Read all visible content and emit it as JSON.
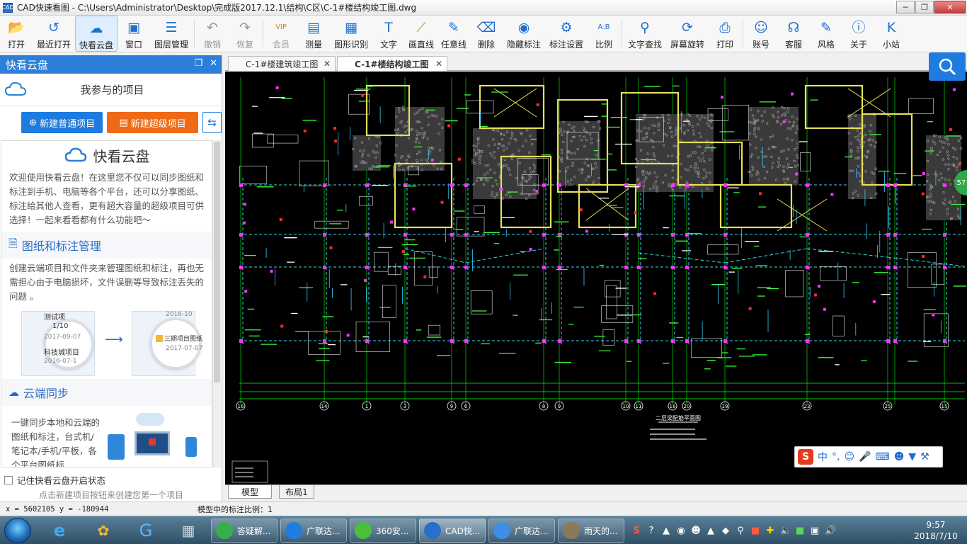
{
  "window": {
    "title": "CAD快速看图 - C:\\Users\\Administrator\\Desktop\\完成版2017.12.1\\结构\\C区\\C-1#楼结构竣工图.dwg",
    "app_icon_text": "CAD"
  },
  "toolbar": {
    "items": [
      {
        "label": "打开",
        "icon": "folder-open-icon"
      },
      {
        "label": "最近打开",
        "icon": "history-icon"
      },
      {
        "label": "快看云盘",
        "icon": "cloud-icon"
      },
      {
        "label": "窗口",
        "icon": "window-fit-icon"
      },
      {
        "label": "图层管理",
        "icon": "layers-icon"
      },
      {
        "label": "撤销",
        "icon": "undo-icon"
      },
      {
        "label": "恢复",
        "icon": "redo-icon"
      },
      {
        "label": "会员",
        "icon": "vip-icon"
      },
      {
        "label": "测量",
        "icon": "ruler-icon"
      },
      {
        "label": "图形识别",
        "icon": "shape-recognition-icon"
      },
      {
        "label": "文字",
        "icon": "text-icon"
      },
      {
        "label": "画直线",
        "icon": "line-icon"
      },
      {
        "label": "任意线",
        "icon": "pencil-icon"
      },
      {
        "label": "删除",
        "icon": "eraser-icon"
      },
      {
        "label": "隐藏标注",
        "icon": "eye-hide-icon"
      },
      {
        "label": "标注设置",
        "icon": "annotation-settings-icon"
      },
      {
        "label": "比例",
        "icon": "scale-icon"
      },
      {
        "label": "文字查找",
        "icon": "text-search-icon"
      },
      {
        "label": "屏幕旋转",
        "icon": "rotate-screen-icon"
      },
      {
        "label": "打印",
        "icon": "printer-icon"
      },
      {
        "label": "账号",
        "icon": "user-icon"
      },
      {
        "label": "客服",
        "icon": "headset-icon"
      },
      {
        "label": "风格",
        "icon": "style-icon"
      },
      {
        "label": "关于",
        "icon": "info-icon"
      },
      {
        "label": "小站",
        "icon": "k-station-icon"
      }
    ]
  },
  "leftpanel": {
    "header": "快看云盘",
    "title": "我参与的项目",
    "new_normal": "新建普通项目",
    "new_super": "新建超级项目",
    "kc_title": "快看云盘",
    "intro": "欢迎使用快看云盘！在这里您不仅可以同步图纸和标注到手机、电脑等各个平台，还可以分享图纸、标注给其他人查看，更有超大容量的超级项目可供选择！一起来看看都有什么功能吧～",
    "sec1_title": "图纸和标注管理",
    "sec1_text": "创建云端项目和文件夹来管理图纸和标注，再也无需担心由于电脑损坏，文件误删等导致标注丢失的问题 。",
    "illus_left": {
      "t1": "测试项",
      "t2": "1/10",
      "t3": "2017-09-07",
      "t4": "科技城项目",
      "t5": "2016-07-1"
    },
    "illus_right": {
      "t1": "2016-10",
      "t2": "三期项目图纸",
      "t3": "2017-07-07"
    },
    "sec2_title": "云端同步",
    "sec2_text": "一键同步本地和云端的图纸和标注，台式机/笔记本/手机/平板，各个平台图纸标",
    "remember": "记住快看云盘开启状态",
    "hint": "点击新建项目按钮来创建您第一个项目"
  },
  "tabs": [
    {
      "label": "C-1#楼建筑竣工图",
      "active": false
    },
    {
      "label": "C-1#楼结构竣工图",
      "active": true
    }
  ],
  "layout_tabs": {
    "model": "模型",
    "layout1": "布局1"
  },
  "status": {
    "coords": "x = 5602105  y = -180944",
    "scale": "模型中的标注比例：1"
  },
  "ime": {
    "lang": "中",
    "punct": "°,"
  },
  "green_badge": "57",
  "taskbar": {
    "tasks": [
      {
        "label": "答疑解...",
        "color": "#35b04a"
      },
      {
        "label": "广联达...",
        "color": "#1f7fe0"
      },
      {
        "label": "360安...",
        "color": "#4bbf3b"
      },
      {
        "label": "CAD快...",
        "color": "#2a6fc9"
      },
      {
        "label": "广联达...",
        "color": "#3d8fe6"
      },
      {
        "label": "雨天的...",
        "color": "#8a7a5a"
      }
    ],
    "time": "9:57",
    "date": "2018/7/10"
  },
  "drawing": {
    "grid_labels": [
      "16",
      "14",
      "1",
      "3",
      "9",
      "6",
      "8",
      "9",
      "10",
      "11",
      "18",
      "20",
      "19",
      "23",
      "25",
      "15"
    ],
    "plan_title": "二层梁配筋平面图"
  }
}
